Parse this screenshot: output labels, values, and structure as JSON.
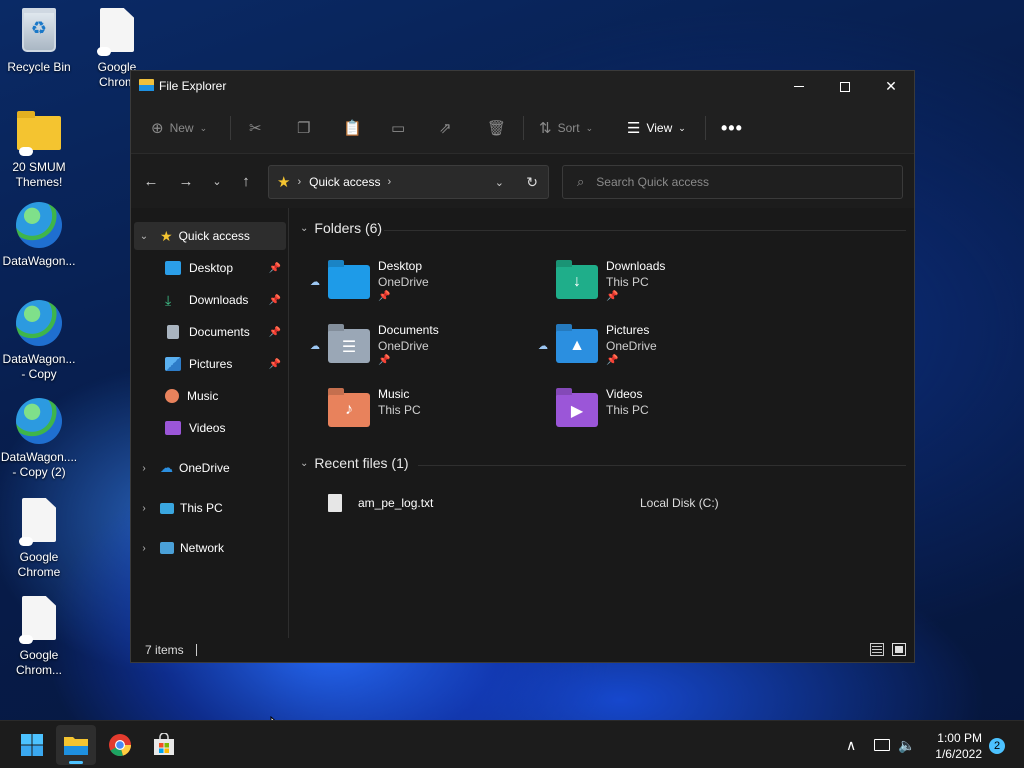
{
  "desktop": {
    "icons": [
      {
        "label": "Recycle Bin"
      },
      {
        "label": "Google Chrom"
      },
      {
        "label": "20 SMUM Themes!"
      },
      {
        "label": "DataWagon..."
      },
      {
        "label": "DataWagon... - Copy"
      },
      {
        "label": "DataWagon.... - Copy (2)"
      },
      {
        "label": "Google Chrome"
      },
      {
        "label": "Google Chrom..."
      }
    ]
  },
  "window": {
    "title": "File Explorer",
    "commands": {
      "new": "New",
      "sort": "Sort",
      "view": "View",
      "more": "•••"
    },
    "address": {
      "location": "Quick access"
    },
    "search": {
      "placeholder": "Search Quick access"
    },
    "nav_pane": {
      "quick_access": "Quick access",
      "items": [
        {
          "label": "Desktop",
          "pinned": true
        },
        {
          "label": "Downloads",
          "pinned": true
        },
        {
          "label": "Documents",
          "pinned": true
        },
        {
          "label": "Pictures",
          "pinned": true
        },
        {
          "label": "Music",
          "pinned": false
        },
        {
          "label": "Videos",
          "pinned": false
        }
      ],
      "onedrive": "OneDrive",
      "this_pc": "This PC",
      "network": "Network"
    },
    "folders_section": {
      "header": "Folders (6)",
      "folders": [
        {
          "name": "Desktop",
          "location": "OneDrive",
          "pinned": true,
          "color": "#1e9be8"
        },
        {
          "name": "Downloads",
          "location": "This PC",
          "pinned": true,
          "color": "#1fae8a"
        },
        {
          "name": "Documents",
          "location": "OneDrive",
          "pinned": true,
          "color": "#9aa7b6"
        },
        {
          "name": "Pictures",
          "location": "OneDrive",
          "pinned": true,
          "color": "#2b8fe0"
        },
        {
          "name": "Music",
          "location": "This PC",
          "pinned": false,
          "color": "#e8825c"
        },
        {
          "name": "Videos",
          "location": "This PC",
          "pinned": false,
          "color": "#9b56d8"
        }
      ]
    },
    "recent_section": {
      "header": "Recent files (1)",
      "files": [
        {
          "name": "am_pe_log.txt",
          "location": "Local Disk (C:)"
        }
      ]
    },
    "status": {
      "items": "7 items"
    }
  },
  "taskbar": {
    "time": "1:00 PM",
    "date": "1/6/2022",
    "notifications": "2"
  }
}
